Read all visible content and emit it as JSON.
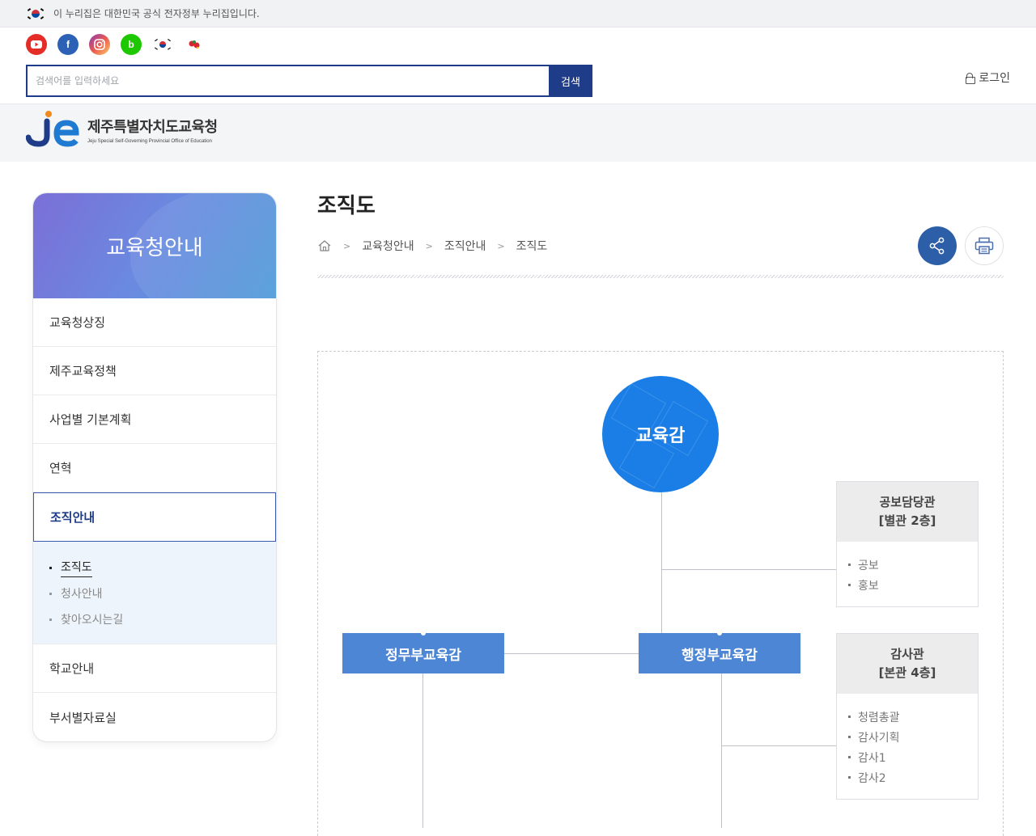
{
  "gov_banner": {
    "text": "이 누리집은 대한민국 공식 전자정부 누리집입니다."
  },
  "social": [
    "youtube-icon",
    "facebook-icon",
    "instagram-icon",
    "blog-icon",
    "taeguk-icon",
    "flower-icon"
  ],
  "search": {
    "placeholder": "검색어를 입력하세요",
    "button": "검색"
  },
  "login": {
    "label": "로그인"
  },
  "logo": {
    "name_ko": "제주특별자치도교육청",
    "name_en": "Jeju Special Self-Governing Provincial Office of Education"
  },
  "sidebar": {
    "title": "교육청안내",
    "items": [
      {
        "label": "교육청상징"
      },
      {
        "label": "제주교육정책"
      },
      {
        "label": "사업별 기본계획"
      },
      {
        "label": "연혁"
      },
      {
        "label": "조직안내"
      },
      {
        "label": "학교안내"
      },
      {
        "label": "부서별자료실"
      }
    ],
    "sub_items": [
      {
        "label": "조직도"
      },
      {
        "label": "청사안내"
      },
      {
        "label": "찾아오시는길"
      }
    ]
  },
  "page": {
    "title": "조직도"
  },
  "breadcrumb": [
    "교육청안내",
    "조직안내",
    "조직도"
  ],
  "org": {
    "chief": "교육감",
    "deputy_left": "정무부교육감",
    "deputy_right": "행정부교육감",
    "offices": [
      {
        "title": "공보담당관",
        "floor": "[별관 2층]",
        "duties": [
          "공보",
          "홍보"
        ]
      },
      {
        "title": "감사관",
        "floor": "[본관 4층]",
        "duties": [
          "청렴총괄",
          "감사기획",
          "감사1",
          "감사2"
        ]
      }
    ]
  },
  "colors": {
    "accent": "#1f3c88",
    "chief": "#1a7ee6",
    "deputy": "#4d86d4"
  }
}
